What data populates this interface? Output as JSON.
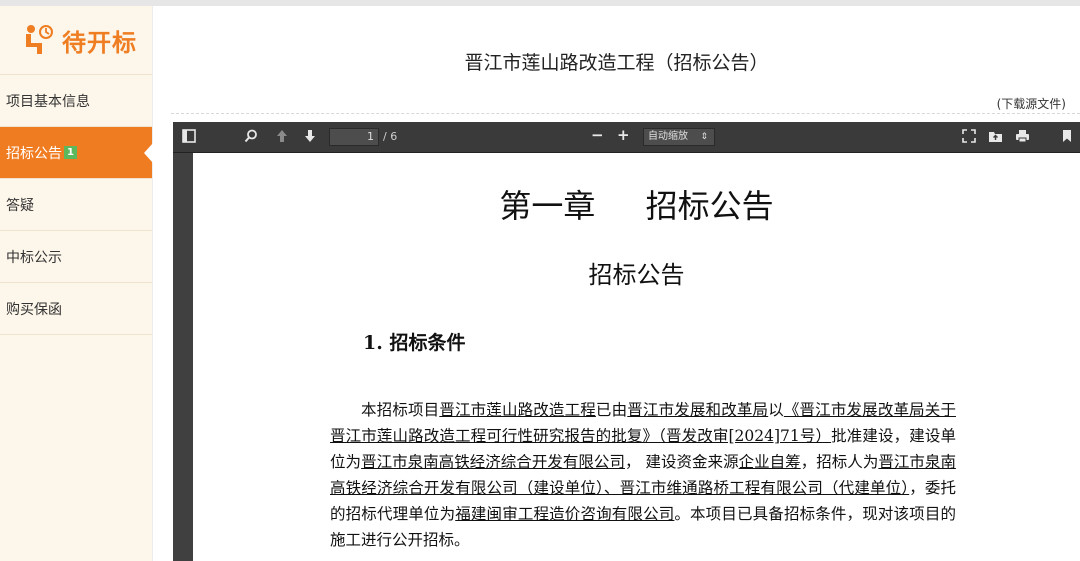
{
  "sidebar": {
    "brand_title": "待开标",
    "menu": [
      {
        "label": "项目基本信息",
        "active": false
      },
      {
        "label": "招标公告",
        "active": true,
        "badge": "1"
      },
      {
        "label": "答疑",
        "active": false
      },
      {
        "label": "中标公示",
        "active": false
      },
      {
        "label": "购买保函",
        "active": false
      }
    ]
  },
  "main": {
    "title": "晋江市莲山路改造工程（招标公告）",
    "download_label": "(下载源文件)"
  },
  "viewer": {
    "page_number": "1",
    "page_total": "/ 6",
    "zoom_label": "自动缩放"
  },
  "document": {
    "chapter_title": "第一章 招标公告",
    "subheading": "招标公告",
    "section_heading": "1. 招标条件",
    "paragraph": {
      "t1": "本招标项目",
      "u1": "晋江市莲山路改造工程",
      "t2": "已由",
      "u2": "晋江市发展和改革局",
      "t3": "以",
      "u3": "《晋江市发展改革局关于晋江市莲山路改造工程可行性研究报告的批复》（晋发改审[2024]71号）",
      "t4": "批准建设，建设单位为",
      "u4": "晋江市泉南高铁经济综合开发有限公司",
      "t5": "， 建设资金来源",
      "u5": "企业自筹",
      "t6": "，招标人为",
      "u6": "晋江市泉南高铁经济综合开发有限公司（建设单位）、晋江市维通路桥工程有限公司（代建单位）",
      "t7": "，委托的招标代理单位为",
      "u7": "福建闽审工程造价咨询有限公司",
      "t8": "。本项目已具备招标条件，现对该项目的施工进行公开招标。"
    }
  },
  "colors": {
    "accent": "#f07c22",
    "badge": "#5cb85c",
    "sidebar_bg": "#fdf6ea",
    "viewer_bg": "#404040"
  }
}
